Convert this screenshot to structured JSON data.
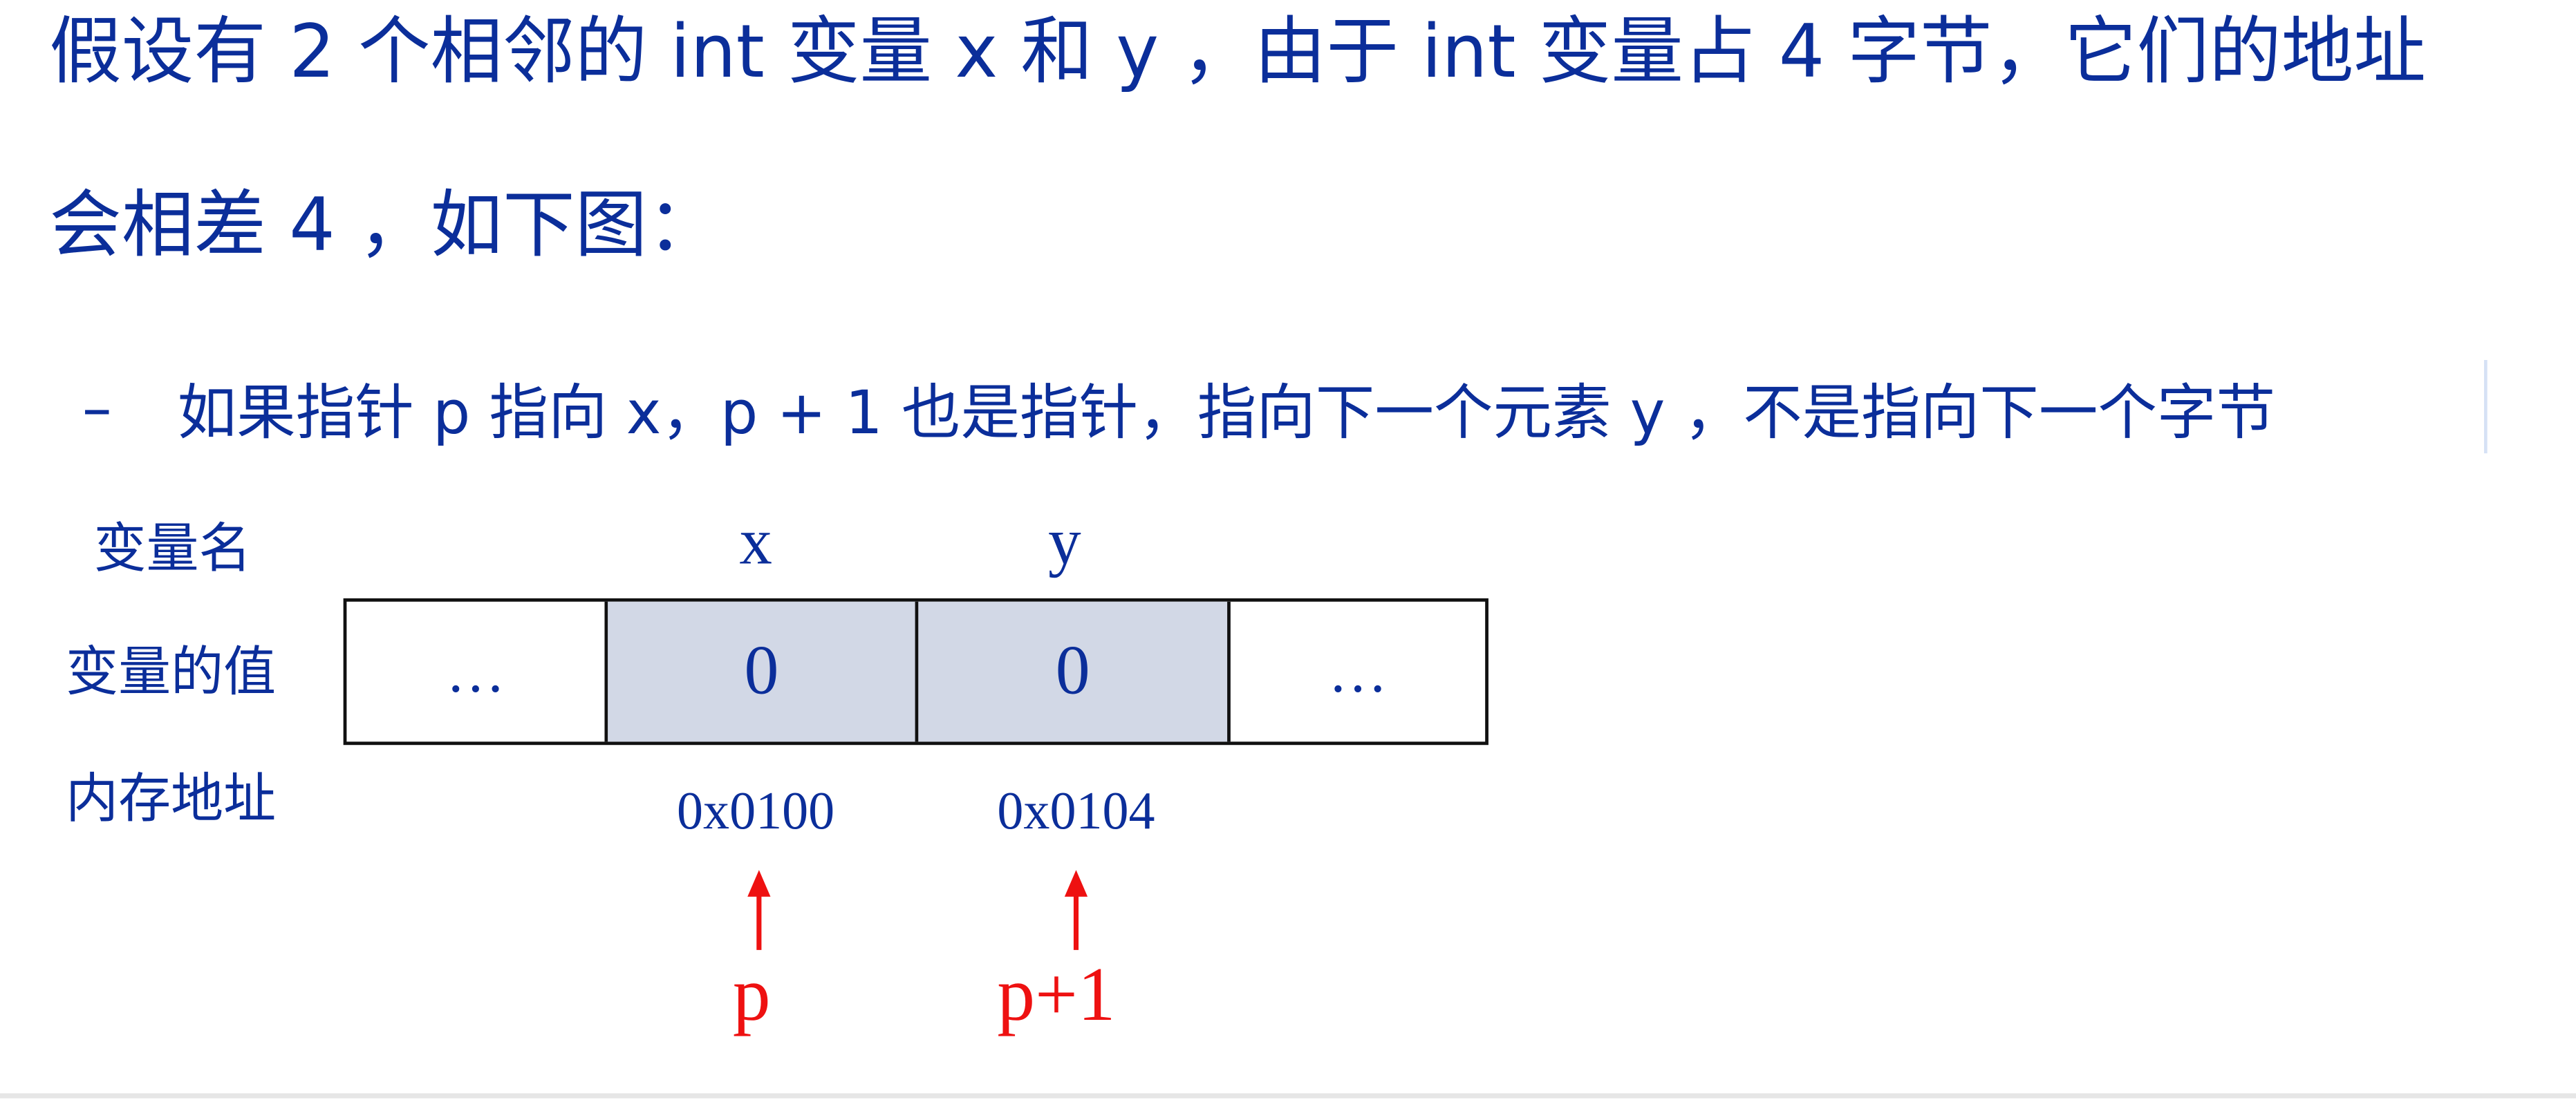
{
  "paragraph": {
    "line1": "假设有 2 个相邻的 int 变量 x 和 y ，由于 int 变量占 4 字节，它们的地址",
    "line2": "会相差 4 ，如下图："
  },
  "bullet": {
    "dash": "–",
    "text": "如果指针 p 指向 x，p + 1 也是指针，指向下一个元素 y ，不是指向下一个字节"
  },
  "diagram": {
    "row_labels": {
      "name": "变量名",
      "value": "变量的值",
      "address": "内存地址"
    },
    "variable_names": [
      "x",
      "y"
    ],
    "cells": [
      "…",
      "0",
      "0",
      "…"
    ],
    "addresses": [
      "0x0100",
      "0x0104"
    ],
    "pointers": [
      "p",
      "p+1"
    ],
    "colors": {
      "text": "#0b2e9a",
      "pointer": "#ee1111",
      "shaded_cell": "#d2d8e6",
      "border": "#111111"
    }
  }
}
